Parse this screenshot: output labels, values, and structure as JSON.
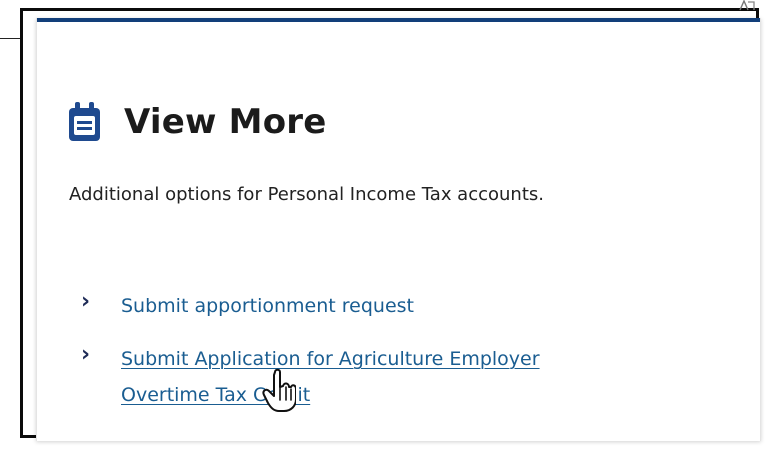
{
  "card": {
    "title": "View More",
    "description": "Additional options for Personal Income Tax accounts."
  },
  "links": [
    {
      "label": "Submit apportionment request"
    },
    {
      "label_line_1": "Submit Application for Agriculture Employer",
      "label_line_2": "Overtime Tax Credit"
    }
  ],
  "icons": {
    "title_icon": "calendar-icon",
    "link_icon": "chevron-right-icon",
    "cursor_icon": "hand-pointer-icon",
    "corner_icon": "partial-window-icon"
  },
  "colors": {
    "accent_bar": "#123f7a",
    "link": "#1a5d91",
    "icon": "#1f4a8f",
    "title": "#1b1b1b"
  }
}
